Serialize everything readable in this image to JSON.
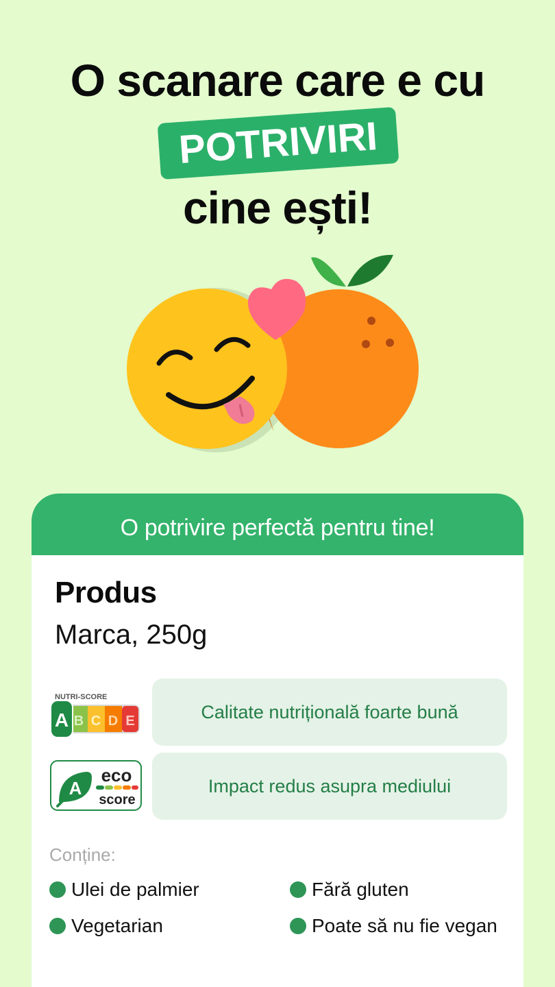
{
  "headline": {
    "line1": "O scanare care e cu",
    "highlight": "POTRIVIRI",
    "line3": "cine ești!"
  },
  "card": {
    "header": "O potrivire perfectă pentru tine!",
    "product_name": "Produs",
    "product_meta": "Marca, 250g",
    "nutri_score": {
      "label": "NUTRI-SCORE",
      "grades": [
        "A",
        "B",
        "C",
        "D",
        "E"
      ],
      "selected": "A",
      "description": "Calitate nutrițională foarte bună"
    },
    "eco_score": {
      "grade": "A",
      "word1": "eco",
      "word2": "score",
      "description": "Impact redus asupra mediului"
    },
    "contains_label": "Conține:",
    "tags": [
      "Ulei de palmier",
      "Fără gluten",
      "Vegetarian",
      "Poate să nu fie vegan"
    ]
  },
  "colors": {
    "background": "#e3fbcd",
    "brand_green": "#33b36b",
    "pill_bg": "#e5f2e7",
    "pill_text": "#237e47",
    "dot": "#2e9556"
  }
}
